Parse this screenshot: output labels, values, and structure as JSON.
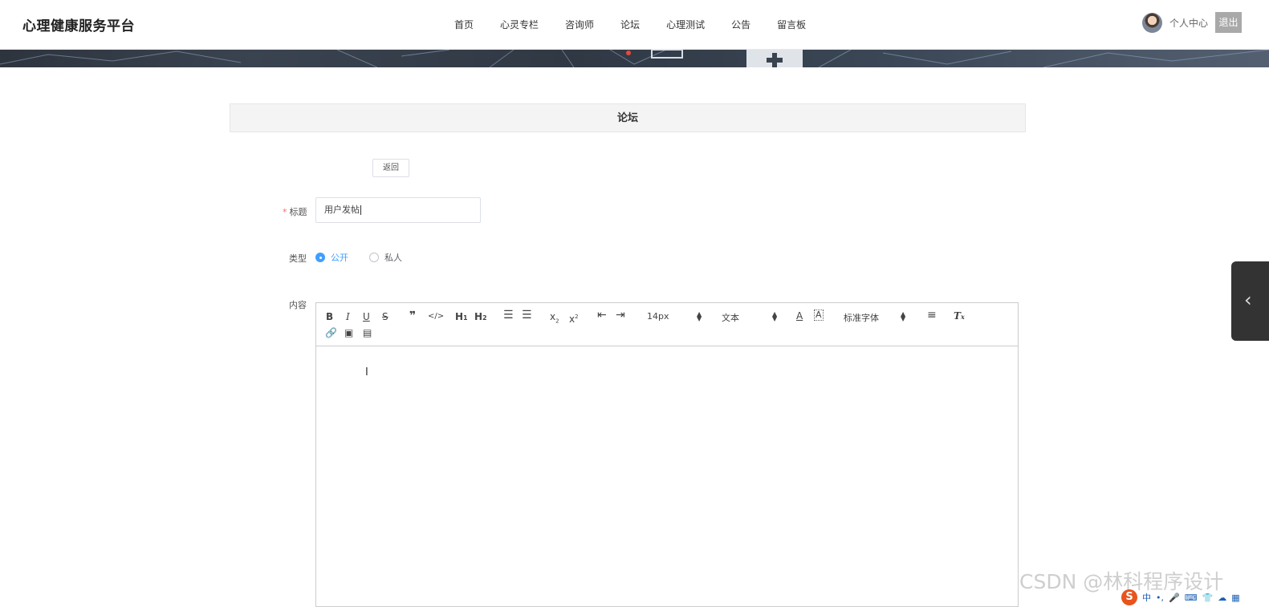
{
  "header": {
    "brand": "心理健康服务平台",
    "nav": [
      "首页",
      "心灵专栏",
      "咨询师",
      "论坛",
      "心理测试",
      "公告",
      "留言板"
    ],
    "user_center": "个人中心",
    "logout": "退出"
  },
  "section": {
    "title": "论坛"
  },
  "form": {
    "back_label": "返回",
    "title_label": "标题",
    "required_mark": "*",
    "title_value": "用户发帖",
    "type_label": "类型",
    "type_options": [
      {
        "label": "公开",
        "selected": true
      },
      {
        "label": "私人",
        "selected": false
      }
    ],
    "content_label": "内容"
  },
  "editor": {
    "font_size": "14px",
    "header_select": "文本",
    "font_family": "标准字体"
  },
  "ime": {
    "mode": "中"
  },
  "watermark": "CSDN @林科程序设计",
  "colors": {
    "accent": "#409eff",
    "required": "#f56c6c",
    "logout_bg": "#a9a9a9"
  }
}
